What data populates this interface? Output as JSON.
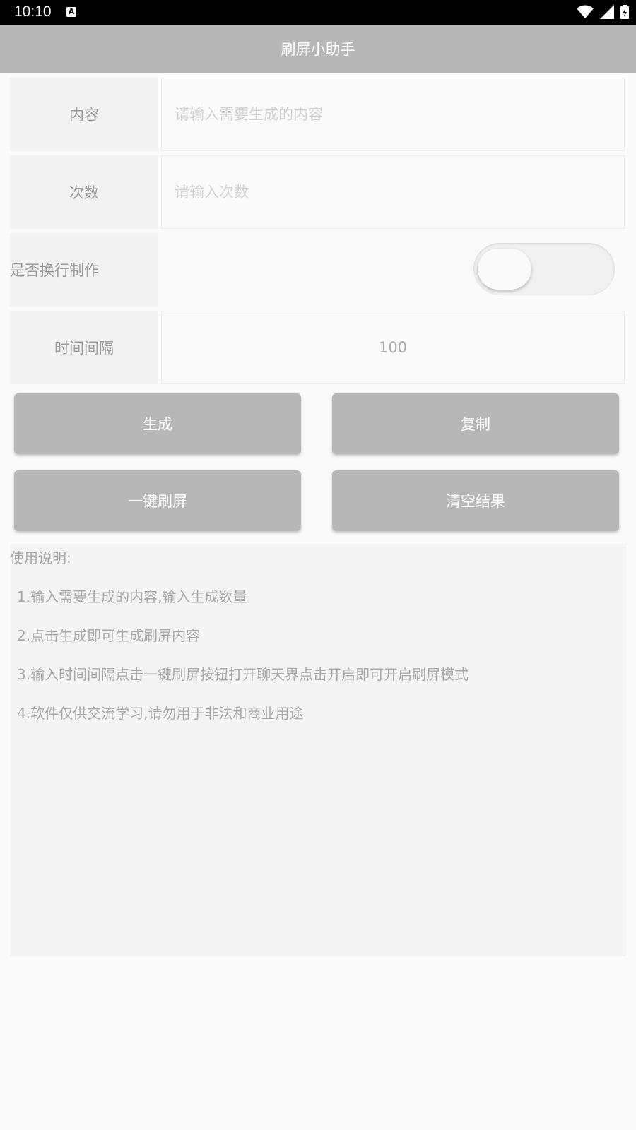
{
  "status_bar": {
    "time": "10:10",
    "a_icon_text": "A"
  },
  "app": {
    "title": "刷屏小助手"
  },
  "form": {
    "content_label": "内容",
    "content_placeholder": "请输入需要生成的内容",
    "count_label": "次数",
    "count_placeholder": "请输入次数",
    "newline_label": "是否换行制作",
    "newline_enabled": false,
    "interval_label": "时间间隔",
    "interval_value": "100"
  },
  "buttons": {
    "generate": "生成",
    "copy": "复制",
    "one_click": "一键刷屏",
    "clear": "清空结果"
  },
  "instructions": {
    "heading": "使用说明:",
    "items": [
      "1.输入需要生成的内容,输入生成数量",
      "2.点击生成即可生成刷屏内容",
      "3.输入时间间隔点击一键刷屏按钮打开聊天界点击开启即可开启刷屏模式",
      "4.软件仅供交流学习,请勿用于非法和商业用途"
    ]
  },
  "colors": {
    "app_bar": "#b7b7b7",
    "button": "#b7b7b7",
    "label_bg": "#f2f2f2",
    "text_muted": "#9a9a9a"
  }
}
